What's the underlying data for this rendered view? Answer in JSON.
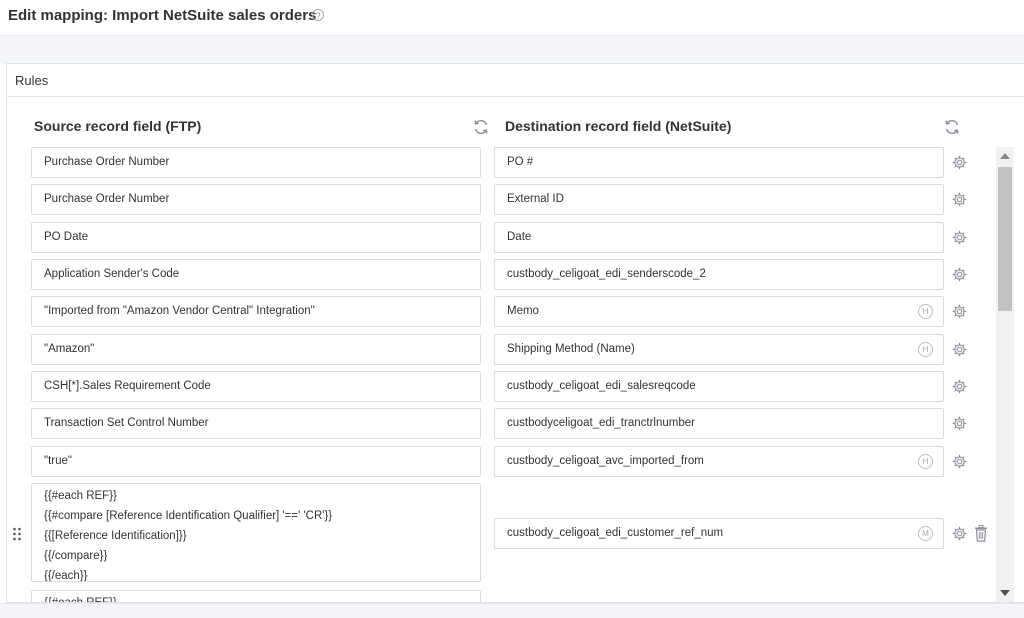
{
  "header": {
    "title": "Edit mapping: Import NetSuite sales orders",
    "help_icon": "?"
  },
  "rules": {
    "label": "Rules"
  },
  "columns": {
    "source": "Source record field (FTP)",
    "destination": "Destination record field (NetSuite)"
  },
  "rows": [
    {
      "source": "Purchase Order Number",
      "destination": "PO #",
      "badge": ""
    },
    {
      "source": "Purchase Order Number",
      "destination": "External ID",
      "badge": ""
    },
    {
      "source": "PO Date",
      "destination": "Date",
      "badge": ""
    },
    {
      "source": "Application Sender's Code",
      "destination": "custbody_celigoat_edi_senderscode_2",
      "badge": ""
    },
    {
      "source": "\"Imported from \"Amazon Vendor Central\" Integration\"",
      "destination": "Memo",
      "badge": "H"
    },
    {
      "source": "\"Amazon\"",
      "destination": "Shipping Method (Name)",
      "badge": "H"
    },
    {
      "source": "CSH[*].Sales Requirement Code",
      "destination": "custbody_celigoat_edi_salesreqcode",
      "badge": ""
    },
    {
      "source": "Transaction Set Control Number",
      "destination": "custbodyceligoat_edi_tranctrlnumber",
      "badge": ""
    },
    {
      "source": "\"true\"",
      "destination": "custbody_celigoat_avc_imported_from",
      "badge": "H"
    }
  ],
  "multi_row": {
    "source_lines": [
      "{{#each REF}}",
      "{{#compare [Reference Identification Qualifier] '==' 'CR'}}",
      "{{[Reference Identification]}}",
      "{{/compare}}",
      "{{/each}}"
    ],
    "destination": "custbody_celigoat_edi_customer_ref_num",
    "badge": "M"
  },
  "partial_row": {
    "source": "{{#each REF}}"
  },
  "icons": {
    "refresh": "refresh-icon",
    "settings": "gear-icon",
    "drag": "drag-handle-icon",
    "delete": "trash-icon"
  },
  "colors": {
    "border": "#d6dae2",
    "band": "#f4f5f8",
    "icon": "#8a8f99"
  }
}
